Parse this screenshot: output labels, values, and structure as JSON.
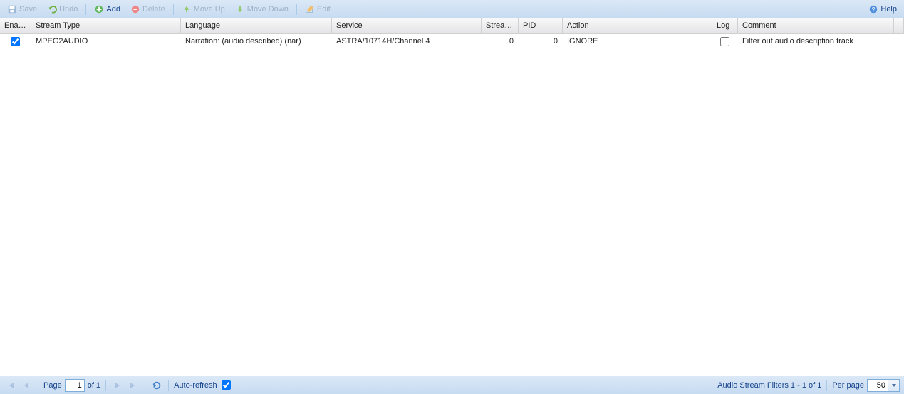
{
  "toolbar": {
    "save": {
      "label": "Save",
      "enabled": false
    },
    "undo": {
      "label": "Undo",
      "enabled": false
    },
    "add": {
      "label": "Add",
      "enabled": true
    },
    "delete": {
      "label": "Delete",
      "enabled": false
    },
    "moveup": {
      "label": "Move Up",
      "enabled": false
    },
    "movedn": {
      "label": "Move Down",
      "enabled": false
    },
    "edit": {
      "label": "Edit",
      "enabled": false
    },
    "help": {
      "label": "Help"
    }
  },
  "columns": {
    "enabled": "Enabled",
    "stream": "Stream Type",
    "lang": "Language",
    "service": "Service",
    "sin": "Stream In...",
    "pid": "PID",
    "action": "Action",
    "log": "Log",
    "comment": "Comment"
  },
  "rows": [
    {
      "enabled": true,
      "stream": "MPEG2AUDIO",
      "lang": "Narration: (audio described) (nar)",
      "service": "ASTRA/10714H/Channel 4",
      "sin": "0",
      "pid": "0",
      "action": "IGNORE",
      "log": false,
      "comment": "Filter out audio description track"
    }
  ],
  "footer": {
    "page_label": "Page",
    "page_value": "1",
    "of_text": "of 1",
    "autorefresh_label": "Auto-refresh",
    "autorefresh": true,
    "status": "Audio Stream Filters 1 - 1 of 1",
    "perpage_label": "Per page",
    "perpage_value": "50"
  }
}
